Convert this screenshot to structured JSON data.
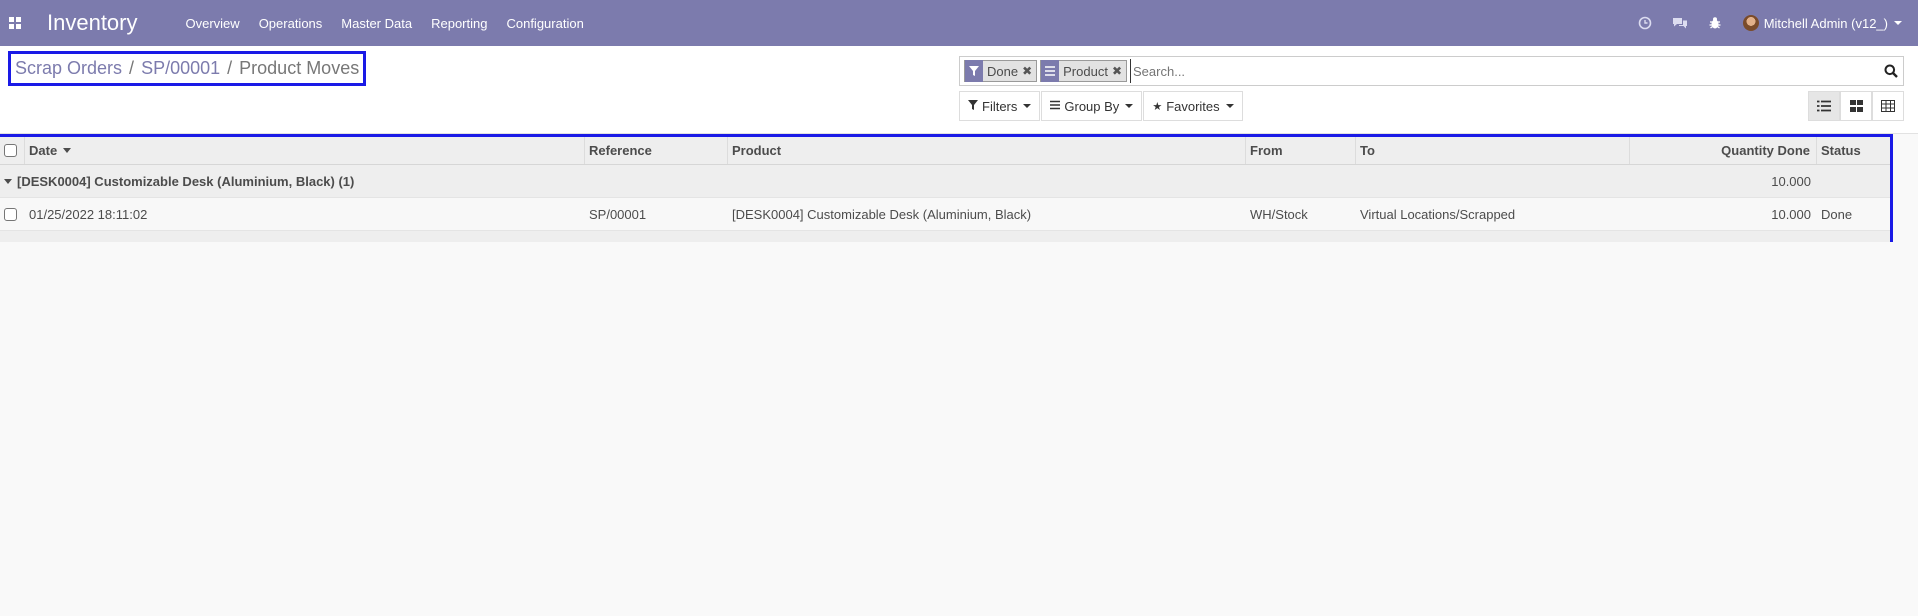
{
  "navbar": {
    "app_title": "Inventory",
    "menu": [
      "Overview",
      "Operations",
      "Master Data",
      "Reporting",
      "Configuration"
    ],
    "user_name": "Mitchell Admin (v12_)",
    "icons": [
      "clock-icon",
      "chat-icon",
      "bug-icon"
    ]
  },
  "breadcrumb": {
    "items": [
      "Scrap Orders",
      "SP/00001"
    ],
    "current": "Product Moves",
    "separator": "/"
  },
  "search": {
    "placeholder": "Search...",
    "facets": [
      {
        "icon": "filter-icon",
        "label": "Done"
      },
      {
        "icon": "group-by-icon",
        "label": "Product"
      }
    ]
  },
  "filters": {
    "filters_label": "Filters",
    "group_by_label": "Group By",
    "favorites_label": "Favorites"
  },
  "views": [
    "list-view-icon",
    "kanban-view-icon",
    "pivot-view-icon"
  ],
  "table": {
    "columns": {
      "date": "Date",
      "reference": "Reference",
      "product": "Product",
      "from": "From",
      "to": "To",
      "quantity_done": "Quantity Done",
      "status": "Status"
    },
    "group": {
      "label": "[DESK0004] Customizable Desk (Aluminium, Black) (1)",
      "quantity": "10.000"
    },
    "rows": [
      {
        "date": "01/25/2022 18:11:02",
        "reference": "SP/00001",
        "product": "[DESK0004] Customizable Desk (Aluminium, Black)",
        "from": "WH/Stock",
        "to": "Virtual Locations/Scrapped",
        "quantity_done": "10.000",
        "status": "Done"
      }
    ]
  },
  "colors": {
    "navbar": "#7c7bad",
    "highlight_border": "#1a1ae6"
  }
}
